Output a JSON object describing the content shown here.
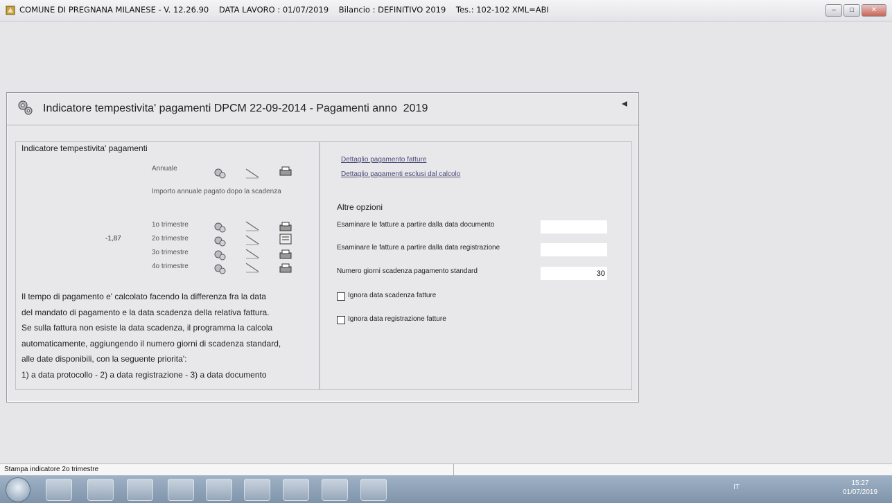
{
  "window": {
    "title": "COMUNE DI PREGNANA MILANESE - V. 12.26.90    DATA LAVORO : 01/07/2019    Bilancio : DEFINITIVO 2019    Tes.: 102-102 XML=ABI"
  },
  "panel": {
    "title": "Indicatore tempestivita' pagamenti DPCM 22-09-2014 - Pagamenti anno  2019",
    "left": {
      "group_label": "Indicatore tempestivita' pagamenti",
      "annual_label": "Annuale",
      "annual_note": "Importo annuale pagato dopo la scadenza",
      "quarters": [
        {
          "label": "1o trimestre",
          "value": ""
        },
        {
          "label": "2o trimestre",
          "value": "-1,87"
        },
        {
          "label": "3o trimestre",
          "value": ""
        },
        {
          "label": "4o trimestre",
          "value": ""
        }
      ],
      "paragraph": [
        "Il tempo di pagamento e' calcolato facendo la differenza fra la data",
        "del mandato di pagamento e la data scadenza della relativa fattura.",
        "Se sulla fattura non esiste la data scadenza, il programma la calcola",
        "automaticamente, aggiungendo il numero giorni di scadenza standard,",
        "alle date disponibili, con la seguente priorita':",
        "1) a data protocollo - 2) a data registrazione - 3) a data documento"
      ]
    },
    "right": {
      "link_invoices": "Dettaglio pagamento fatture",
      "link_excluded": "Dettaglio pagamenti esclusi dal calcolo",
      "options_title": "Altre opzioni",
      "opt_doc_date_label": "Esaminare le fatture a partire dalla data documento",
      "opt_doc_date_value": "",
      "opt_reg_date_label": "Esaminare le fatture a partire dalla data registrazione",
      "opt_reg_date_value": "",
      "opt_days_label": "Numero giorni scadenza pagamento standard",
      "opt_days_value": "30",
      "chk_ignore_due_label": "Ignora data scadenza fatture",
      "chk_ignore_reg_label": "Ignora data registrazione fatture"
    }
  },
  "statusbar": {
    "text": "Stampa indicatore 2o trimestre"
  },
  "taskbar": {
    "language": "IT",
    "time": "15:27",
    "date": "01/07/2019",
    "apps": [
      "outlook-icon",
      "excel-icon",
      "word-icon",
      "folder-icon",
      "internet-explorer-icon",
      "chrome-icon",
      "visio-icon",
      "media-icon",
      "app-icon"
    ]
  }
}
